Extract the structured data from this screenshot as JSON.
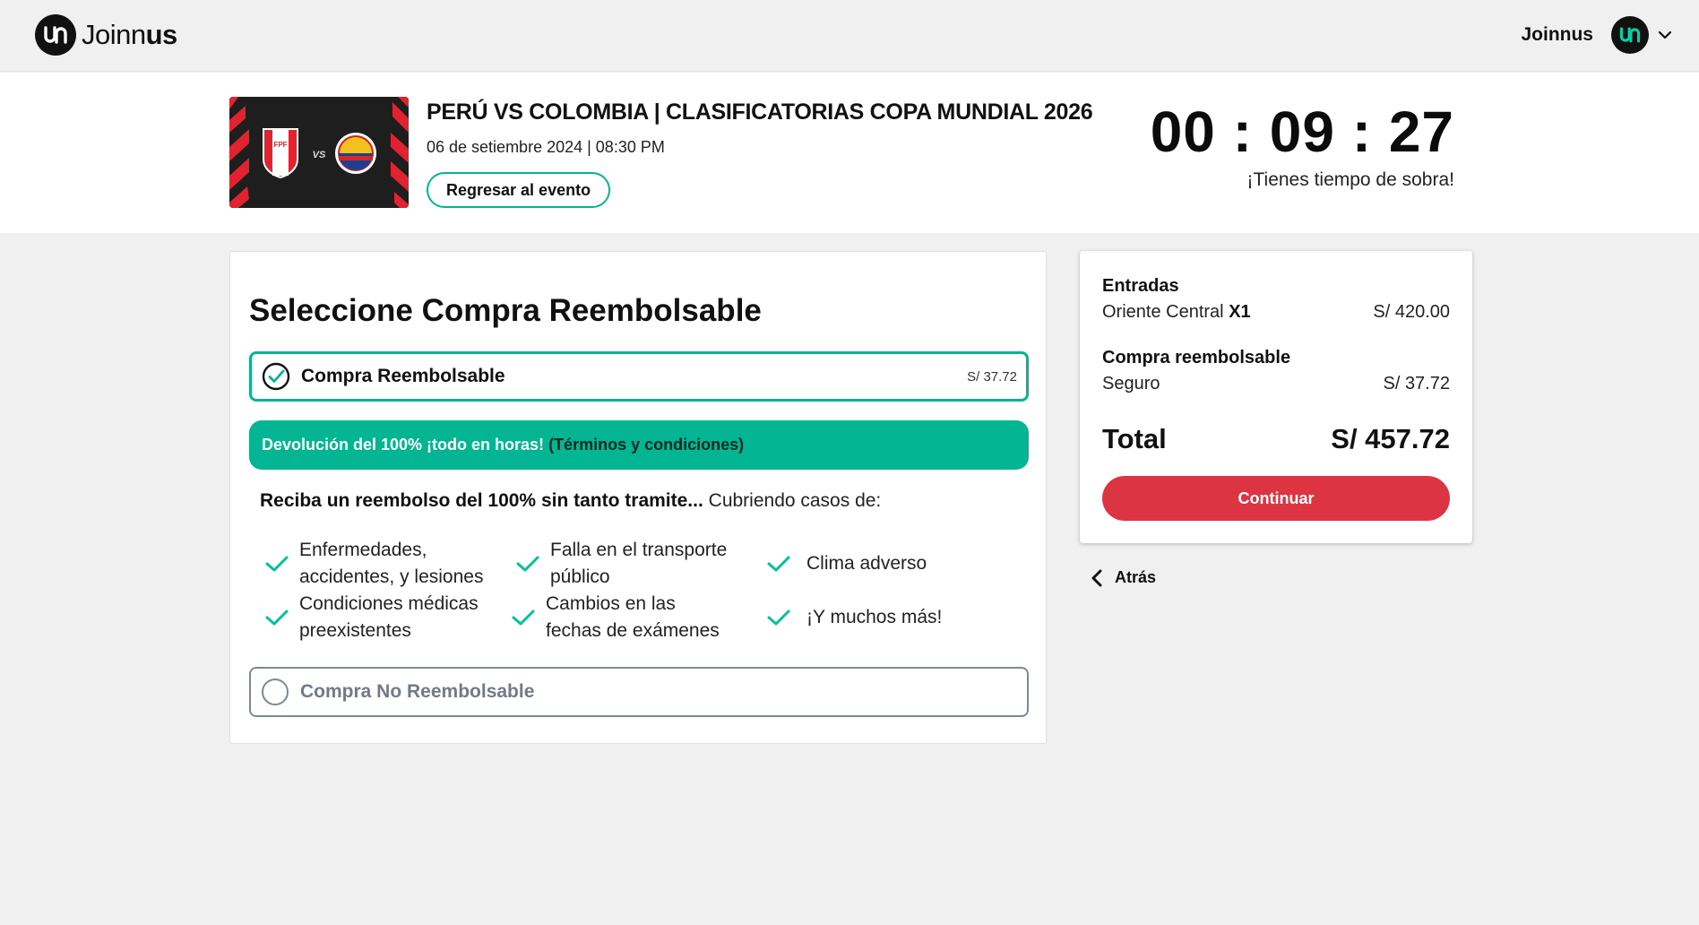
{
  "header": {
    "logo_text_light": "Joinn",
    "logo_text_bold": "us",
    "user_name": "Joinnus"
  },
  "event": {
    "title": "PERÚ VS COLOMBIA | CLASIFICATORIAS COPA MUNDIAL 2026",
    "date": "06 de setiembre 2024 | 08:30 PM",
    "back_button": "Regresar al evento",
    "thumb_vs": "VS",
    "thumb_crest": "FPF"
  },
  "timer": {
    "display": "00 : 09 : 27",
    "note": "¡Tienes tiempo de sobra!"
  },
  "selection": {
    "title": "Seleccione Compra Reembolsable",
    "refundable_label": "Compra Reembolsable",
    "refundable_price": "S/ 37.72",
    "banner_highlight": "Devolución del 100% ¡todo en horas!",
    "banner_terms": "(Términos y condiciones)",
    "cover_bold": "Reciba un reembolso del 100% sin tanto tramite...",
    "cover_rest": " Cubriendo casos de:",
    "cases": [
      {
        "line1": "Enfermedades,",
        "line2": "accidentes, y lesiones"
      },
      {
        "line1": "Falla en el transporte",
        "line2": "público"
      },
      {
        "line1": "Clima adverso",
        "line2": ""
      },
      {
        "line1": "Condiciones médicas",
        "line2": "preexistentes"
      },
      {
        "line1": "Cambios en las",
        "line2": "fechas de exámenes"
      },
      {
        "line1": "¡Y muchos más!",
        "line2": ""
      }
    ],
    "non_refundable_label": "Compra No Reembolsable"
  },
  "summary": {
    "tickets_heading": "Entradas",
    "ticket_name": "Oriente Central",
    "ticket_qty": "X1",
    "ticket_price": "S/ 420.00",
    "refund_heading": "Compra reembolsable",
    "insurance_label": "Seguro",
    "insurance_price": "S/ 37.72",
    "total_label": "Total",
    "total_value": "S/ 457.72",
    "continue_label": "Continuar",
    "back_label": "Atrás"
  },
  "colors": {
    "accent_green": "#03b592",
    "cta_red": "#dd3444"
  }
}
